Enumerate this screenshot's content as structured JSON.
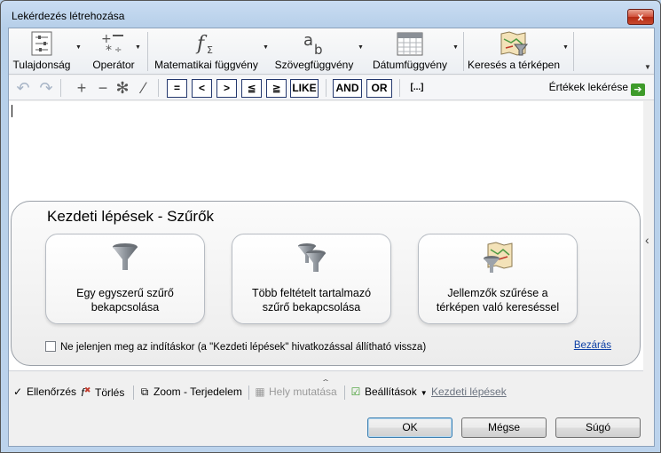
{
  "window": {
    "title": "Lekérdezés létrehozása",
    "close_glyph": "x"
  },
  "ribbon": {
    "items": [
      {
        "label": "Tulajdonság",
        "icon": "property-sliders-icon"
      },
      {
        "label": "Operátor",
        "icon": "operators-icon"
      },
      {
        "label": "Matematikai függvény",
        "icon": "math-function-icon"
      },
      {
        "label": "Szövegfüggvény",
        "icon": "text-function-icon"
      },
      {
        "label": "Dátumfüggvény",
        "icon": "calendar-icon"
      },
      {
        "label": "Keresés a térképen",
        "icon": "map-filter-icon"
      }
    ]
  },
  "operators": {
    "boxes": [
      "=",
      "<",
      ">",
      "≦",
      "≧",
      "LIKE",
      "AND",
      "OR"
    ],
    "ellipsis": "[...]",
    "get_values": "Értékek lekérése"
  },
  "getting_started": {
    "title": "Kezdeti lépések - Szűrők",
    "cards": [
      {
        "line1": "Egy egyszerű szűrő",
        "line2": "bekapcsolása",
        "icon": "funnel-icon"
      },
      {
        "line1": "Több feltételt tartalmazó",
        "line2": "szűrő bekapcsolása",
        "icon": "double-funnel-icon"
      },
      {
        "line1": "Jellemzők szűrése a",
        "line2": "térképen való kereséssel",
        "icon": "map-funnel-icon"
      }
    ],
    "dont_show": "Ne jelenjen meg az indításkor (a \"Kezdeti lépések\" hivatkozással állítható vissza)",
    "close": "Bezárás"
  },
  "bottom_toolbar": {
    "check": "Ellenőrzés",
    "delete": "Törlés",
    "zoom": "Zoom - Terjedelem",
    "show_location": "Hely mutatása",
    "settings": "Beállítások",
    "getting_started_link": "Kezdeti lépések"
  },
  "buttons": {
    "ok": "OK",
    "cancel": "Mégse",
    "help": "Súgó"
  },
  "colors": {
    "accent_green": "#3e9b2b",
    "link_blue": "#0b3fa5",
    "close_red": "#c84a2e"
  }
}
